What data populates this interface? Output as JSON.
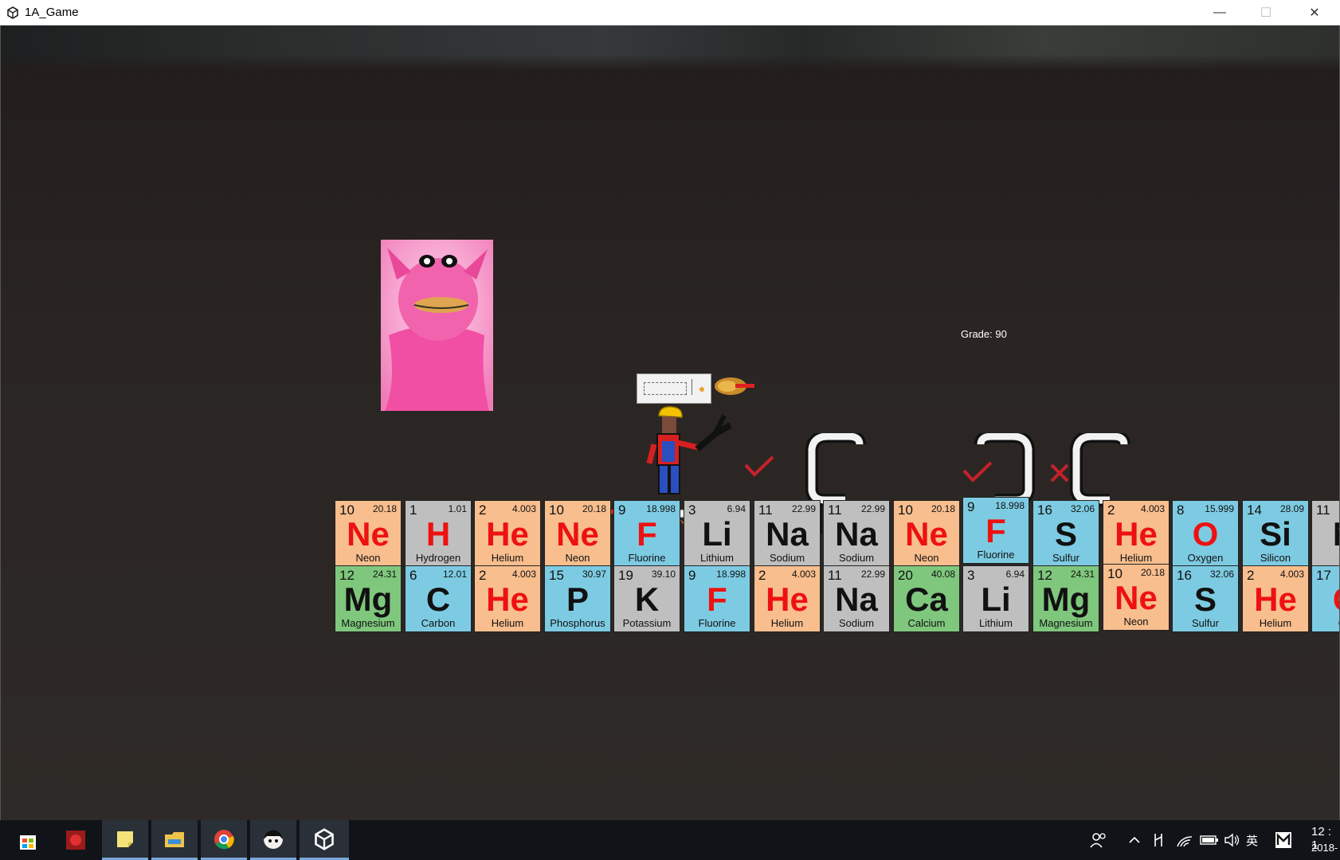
{
  "window": {
    "title": "1A_Game",
    "minimize": "—",
    "maximize": "☐",
    "close": "✕"
  },
  "hud": {
    "grade_text": "Grade: 90"
  },
  "colors": {
    "neon": "#f8be8e",
    "gray": "#bfbfbf",
    "blue": "#7dcbe2",
    "green": "#7fc77d",
    "red_symbol": "#ee1111",
    "black_symbol": "#111111"
  },
  "tiles_row1": [
    {
      "num": "10",
      "mass": "20.18",
      "sym": "Ne",
      "name": "Neon",
      "color": "neon",
      "red": true
    },
    {
      "num": "1",
      "mass": "1.01",
      "sym": "H",
      "name": "Hydrogen",
      "color": "gray",
      "red": true
    },
    {
      "num": "2",
      "mass": "4.003",
      "sym": "He",
      "name": "Helium",
      "color": "neon",
      "red": true
    },
    {
      "num": "10",
      "mass": "20.18",
      "sym": "Ne",
      "name": "Neon",
      "color": "neon",
      "red": true
    },
    {
      "num": "9",
      "mass": "18.998",
      "sym": "F",
      "name": "Fluorine",
      "color": "blue",
      "red": true
    },
    {
      "num": "3",
      "mass": "6.94",
      "sym": "Li",
      "name": "Lithium",
      "color": "gray",
      "red": false
    },
    {
      "num": "11",
      "mass": "22.99",
      "sym": "Na",
      "name": "Sodium",
      "color": "gray",
      "red": false
    },
    {
      "num": "11",
      "mass": "22.99",
      "sym": "Na",
      "name": "Sodium",
      "color": "gray",
      "red": false
    },
    {
      "num": "10",
      "mass": "20.18",
      "sym": "Ne",
      "name": "Neon",
      "color": "neon",
      "red": true
    },
    {
      "num": "9",
      "mass": "18.998",
      "sym": "F",
      "name": "Fluorine",
      "color": "blue",
      "red": true
    },
    {
      "num": "16",
      "mass": "32.06",
      "sym": "S",
      "name": "Sulfur",
      "color": "blue",
      "red": false
    },
    {
      "num": "2",
      "mass": "4.003",
      "sym": "He",
      "name": "Helium",
      "color": "neon",
      "red": true
    },
    {
      "num": "8",
      "mass": "15.999",
      "sym": "O",
      "name": "Oxygen",
      "color": "blue",
      "red": true
    },
    {
      "num": "14",
      "mass": "28.09",
      "sym": "Si",
      "name": "Silicon",
      "color": "blue",
      "red": false
    },
    {
      "num": "11",
      "mass": "",
      "sym": "N",
      "name": "So",
      "color": "gray",
      "red": false
    }
  ],
  "tiles_row2": [
    {
      "num": "12",
      "mass": "24.31",
      "sym": "Mg",
      "name": "Magnesium",
      "color": "green",
      "red": false
    },
    {
      "num": "6",
      "mass": "12.01",
      "sym": "C",
      "name": "Carbon",
      "color": "blue",
      "red": false
    },
    {
      "num": "2",
      "mass": "4.003",
      "sym": "He",
      "name": "Helium",
      "color": "neon",
      "red": true
    },
    {
      "num": "15",
      "mass": "30.97",
      "sym": "P",
      "name": "Phosphorus",
      "color": "blue",
      "red": false
    },
    {
      "num": "19",
      "mass": "39.10",
      "sym": "K",
      "name": "Potassium",
      "color": "gray",
      "red": false
    },
    {
      "num": "9",
      "mass": "18.998",
      "sym": "F",
      "name": "Fluorine",
      "color": "blue",
      "red": true
    },
    {
      "num": "2",
      "mass": "4.003",
      "sym": "He",
      "name": "Helium",
      "color": "neon",
      "red": true
    },
    {
      "num": "11",
      "mass": "22.99",
      "sym": "Na",
      "name": "Sodium",
      "color": "gray",
      "red": false
    },
    {
      "num": "20",
      "mass": "40.08",
      "sym": "Ca",
      "name": "Calcium",
      "color": "green",
      "red": false
    },
    {
      "num": "3",
      "mass": "6.94",
      "sym": "Li",
      "name": "Lithium",
      "color": "gray",
      "red": false
    },
    {
      "num": "12",
      "mass": "24.31",
      "sym": "Mg",
      "name": "Magnesium",
      "color": "green",
      "red": false
    },
    {
      "num": "10",
      "mass": "20.18",
      "sym": "Ne",
      "name": "Neon",
      "color": "neon",
      "red": true
    },
    {
      "num": "16",
      "mass": "32.06",
      "sym": "S",
      "name": "Sulfur",
      "color": "blue",
      "red": false
    },
    {
      "num": "2",
      "mass": "4.003",
      "sym": "He",
      "name": "Helium",
      "color": "neon",
      "red": true
    },
    {
      "num": "17",
      "mass": "",
      "sym": "C",
      "name": "Ch",
      "color": "blue",
      "red": true
    }
  ],
  "taskbar": {
    "apps": [
      "store-icon",
      "game-app-icon",
      "sticky-notes-icon",
      "file-explorer-icon",
      "chrome-icon",
      "anime-avatar-icon",
      "unity-icon"
    ],
    "tray_ime": "英",
    "clock_time": "12 : 1",
    "clock_date": "2018-"
  }
}
